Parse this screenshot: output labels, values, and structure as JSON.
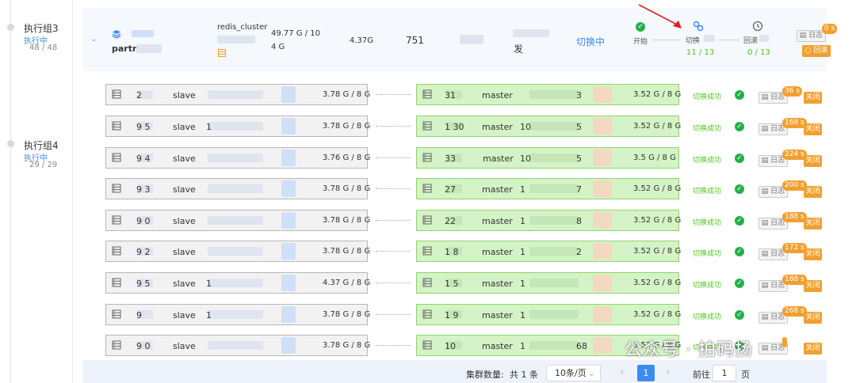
{
  "groups": [
    {
      "name": "执行组3",
      "status": "执行中",
      "count": "48 / 48"
    },
    {
      "name": "执行组4",
      "status": "执行中",
      "count": "29 / 29"
    }
  ],
  "cluster": {
    "name_prefix": "partn",
    "type": "redis_cluster",
    "type_sub": "",
    "memory_line1": "49.77 G / 10",
    "memory_line2": "4 G",
    "used": "4.37G",
    "count": "751",
    "status_char": "发",
    "status": "切换中"
  },
  "steps": [
    {
      "label": "开始",
      "progress": ""
    },
    {
      "label": "切换",
      "progress": "11 / 13"
    },
    {
      "label": "回滚",
      "progress": "0 / 13"
    }
  ],
  "header_actions": {
    "log": "日志",
    "time": "0 s",
    "rollback": "回滚"
  },
  "rows": [
    {
      "left_id": "2",
      "left_role": "slave",
      "left_ip": "",
      "left_mem": "3.78 G / 8 G",
      "right_id": "31",
      "right_role": "master",
      "right_ip": "",
      "right_tail": "3",
      "right_mem": "3.52 G / 8 G",
      "state": "切换成功",
      "log": "日志",
      "secs": "36 s",
      "close": "关闭"
    },
    {
      "left_id": "9  5",
      "left_role": "slave",
      "left_ip": "1",
      "left_mem": "3.78 G / 8 G",
      "right_id": "1  30",
      "right_role": "master",
      "right_ip": "10",
      "right_tail": "5",
      "right_mem": "3.52 G / 8 G",
      "state": "切换成功",
      "log": "日志",
      "secs": "168 s",
      "close": "关闭"
    },
    {
      "left_id": "9  4",
      "left_role": "slave",
      "left_ip": "",
      "left_mem": "3.76 G / 8 G",
      "right_id": "33",
      "right_role": "master",
      "right_ip": "10",
      "right_tail": "5",
      "right_mem": "3.5 G / 8 G",
      "state": "切换成功",
      "log": "日志",
      "secs": "224 s",
      "close": "关闭"
    },
    {
      "left_id": "9  3",
      "left_role": "slave",
      "left_ip": "",
      "left_mem": "3.78 G / 8 G",
      "right_id": "27",
      "right_role": "master",
      "right_ip": "1",
      "right_tail": "7",
      "right_mem": "3.52 G / 8 G",
      "state": "切换成功",
      "log": "日志",
      "secs": "200 s",
      "close": "关闭"
    },
    {
      "left_id": "9  0",
      "left_role": "slave",
      "left_ip": "",
      "left_mem": "3.78 G / 8 G",
      "right_id": "22",
      "right_role": "master",
      "right_ip": "1",
      "right_tail": "8",
      "right_mem": "3.52 G / 8 G",
      "state": "切换成功",
      "log": "日志",
      "secs": "188 s",
      "close": "关闭"
    },
    {
      "left_id": "9  2",
      "left_role": "slave",
      "left_ip": "",
      "left_mem": "3.78 G / 8 G",
      "right_id": "1  8",
      "right_role": "master",
      "right_ip": "1",
      "right_tail": "2",
      "right_mem": "3.52 G / 8 G",
      "state": "切换成功",
      "log": "日志",
      "secs": "172 s",
      "close": "关闭"
    },
    {
      "left_id": "9  5",
      "left_role": "slave",
      "left_ip": "1",
      "left_mem": "4.37 G / 8 G",
      "right_id": "1  5",
      "right_role": "master",
      "right_ip": "1",
      "right_tail": "",
      "right_mem": "3.52 G / 8 G",
      "state": "切换成功",
      "log": "日志",
      "secs": "188 s",
      "close": "关闭"
    },
    {
      "left_id": "9",
      "left_role": "slave",
      "left_ip": "1",
      "left_mem": "3.78 G / 8 G",
      "right_id": "1  9",
      "right_role": "master",
      "right_ip": "1",
      "right_tail": "",
      "right_mem": "3.52 G / 8 G",
      "state": "切换成功",
      "log": "日志",
      "secs": "268 s",
      "close": "关闭"
    },
    {
      "left_id": "9  0",
      "left_role": "slave",
      "left_ip": "",
      "left_mem": "3.78 G / 8 G",
      "right_id": "10",
      "right_role": "master",
      "right_ip": "1",
      "right_tail": "68",
      "right_mem": "3.52 G / 8 G",
      "state": "切换成功",
      "log": "日志",
      "secs": "",
      "close": "关闭"
    }
  ],
  "pagination": {
    "total_label": "集群数量:",
    "total": "共 1 条",
    "page_size": "10条/页",
    "prev": "‹",
    "current": "1",
    "next": "›",
    "goto_label": "前往",
    "goto_value": "1",
    "page_unit": "页"
  },
  "watermark": {
    "text": "公众号 · 拍码扬"
  },
  "colors": {
    "accent": "#3c8cf0",
    "success": "#52c41a",
    "warning": "#f0a030",
    "annotation": "#e02020"
  }
}
